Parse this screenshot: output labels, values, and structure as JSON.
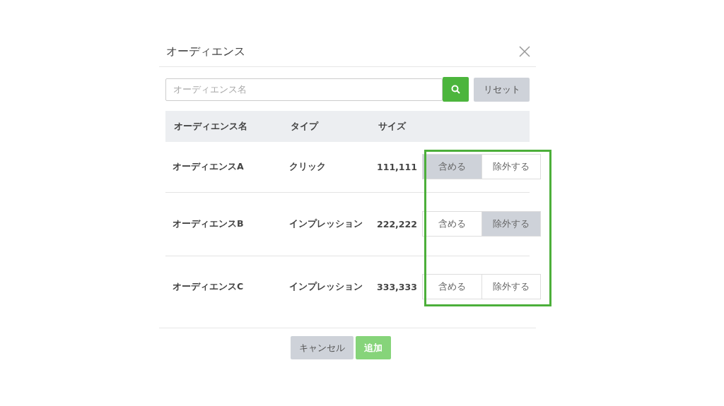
{
  "dialog": {
    "title": "オーディエンス"
  },
  "search": {
    "placeholder": "オーディエンス名",
    "reset_label": "リセット"
  },
  "table": {
    "columns": [
      "オーディエンス名",
      "タイプ",
      "サイズ"
    ],
    "rows": [
      {
        "name": "オーディエンスA",
        "type": "クリック",
        "size": "111,111",
        "options": [
          {
            "label": "含める",
            "selected": true
          },
          {
            "label": "除外する",
            "selected": false
          }
        ]
      },
      {
        "name": "オーディエンスB",
        "type": "インプレッション",
        "size": "222,222",
        "options": [
          {
            "label": "含める",
            "selected": false
          },
          {
            "label": "除外する",
            "selected": true
          }
        ]
      },
      {
        "name": "オーディエンスC",
        "type": "インプレッション",
        "size": "333,333",
        "options": [
          {
            "label": "含める",
            "selected": false
          },
          {
            "label": "除外する",
            "selected": false
          }
        ]
      }
    ]
  },
  "footer": {
    "buttons": [
      {
        "label": "キャンセル",
        "kind": "secondary",
        "disabled": false
      },
      {
        "label": "追加",
        "kind": "primary",
        "disabled": true
      }
    ]
  }
}
